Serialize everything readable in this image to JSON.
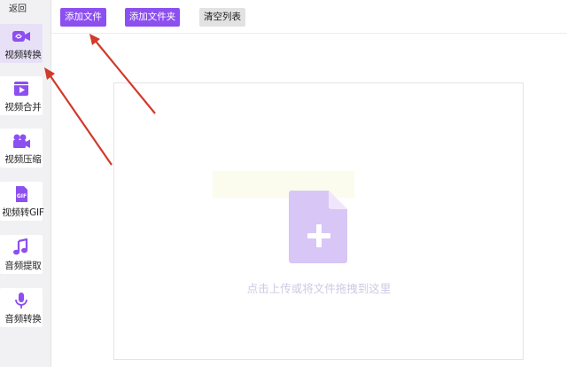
{
  "sidebar": {
    "back_label": "返回",
    "items": [
      {
        "label": "视频转换",
        "icon": "video-convert-icon",
        "active": true
      },
      {
        "label": "视频合并",
        "icon": "video-merge-icon",
        "active": false
      },
      {
        "label": "视频压缩",
        "icon": "video-compress-icon",
        "active": false
      },
      {
        "label": "视频转GIF",
        "icon": "gif-icon",
        "active": false
      },
      {
        "label": "音频提取",
        "icon": "music-note-icon",
        "active": false
      },
      {
        "label": "音频转换",
        "icon": "microphone-icon",
        "active": false
      }
    ]
  },
  "toolbar": {
    "add_file_label": "添加文件",
    "add_folder_label": "添加文件夹",
    "clear_list_label": "清空列表"
  },
  "dropzone": {
    "hint": "点击上传或将文件拖拽到这里",
    "icon": "file-add-icon"
  },
  "colors": {
    "accent": "#8c4ff0",
    "accent_light": "#c9aef3",
    "annotation_arrow": "#d23a2a"
  }
}
